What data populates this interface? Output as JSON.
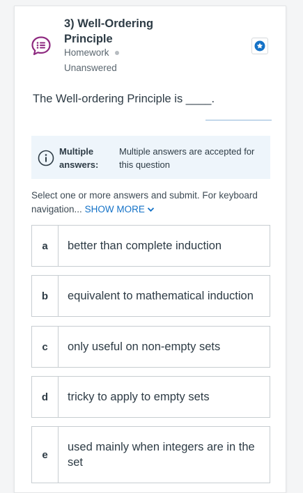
{
  "question": {
    "title": "3) Well-Ordering Principle",
    "type": "Homework",
    "status": "Unanswered",
    "prompt": "The Well-ordering Principle is ____."
  },
  "info_box": {
    "label": "Multiple answers:",
    "text": "Multiple answers are accepted for this question"
  },
  "instructions": {
    "text": "Select one or more answers and submit. For keyboard navigation...",
    "show_more": "SHOW MORE"
  },
  "options": [
    {
      "letter": "a",
      "text": "better than complete induction"
    },
    {
      "letter": "b",
      "text": "equivalent to mathematical induction"
    },
    {
      "letter": "c",
      "text": "only useful on non-empty sets"
    },
    {
      "letter": "d",
      "text": "tricky to apply to empty sets"
    },
    {
      "letter": "e",
      "text": "used mainly when integers are in the set"
    }
  ],
  "colors": {
    "accent": "#1472c7",
    "question_icon": "#8e2a80",
    "info_bg": "#eef5fb"
  },
  "icons": [
    "question-list-icon",
    "star-bookmark-icon",
    "info-icon",
    "chevron-down-icon"
  ]
}
